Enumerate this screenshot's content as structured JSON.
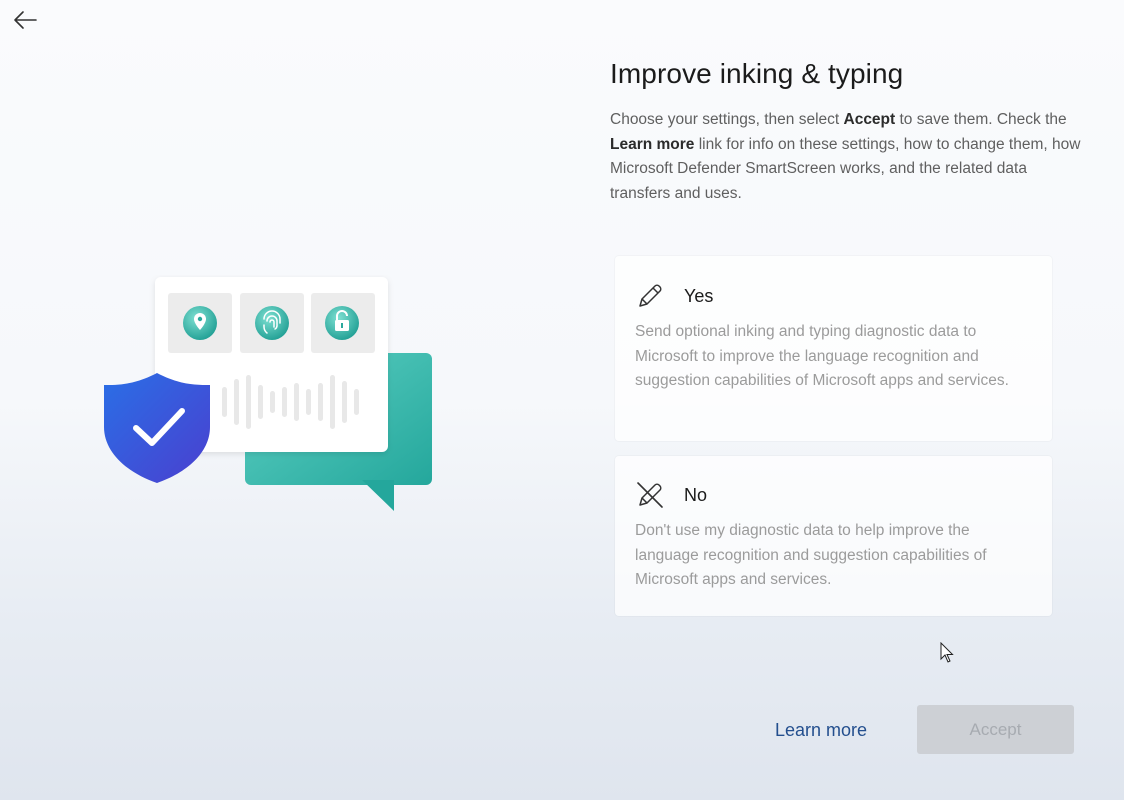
{
  "nav": {
    "back_icon": "back-arrow-icon"
  },
  "header": {
    "title": "Improve inking & typing"
  },
  "description": {
    "part1": "Choose your settings, then select ",
    "accept_bold": "Accept",
    "part2": " to save them. Check the ",
    "learn_more_bold": "Learn more",
    "part3": " link for info on these settings, how to change them, how Microsoft Defender SmartScreen works, and the related data transfers and uses."
  },
  "options": {
    "yes": {
      "icon": "pen-icon",
      "label": "Yes",
      "description": "Send optional inking and typing diagnostic data to Microsoft to improve the language recognition and suggestion capabilities of Microsoft apps and services."
    },
    "no": {
      "icon": "pen-off-icon",
      "label": "No",
      "description": "Don't use my diagnostic data to help improve the language recognition and suggestion capabilities of Microsoft apps and services."
    }
  },
  "footer": {
    "learn_more_label": "Learn more",
    "accept_label": "Accept"
  },
  "colors": {
    "accent": "#234f8e",
    "teal": "#2fb0a6",
    "shield": "#2b5fd9",
    "disabled_button": "#cdd0d5"
  }
}
